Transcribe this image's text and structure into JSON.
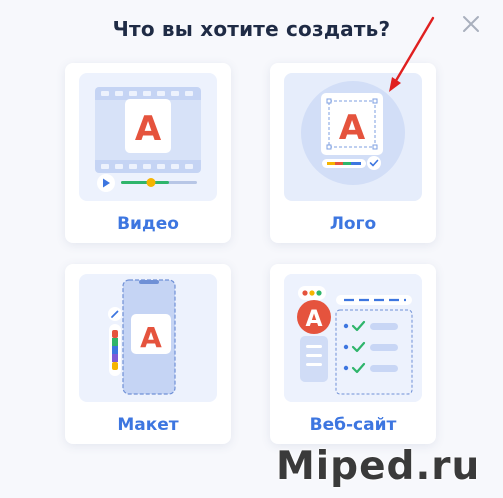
{
  "dialog": {
    "title": "Что вы хотите создать?",
    "close_icon": "close-icon"
  },
  "options": [
    {
      "label": "Видео",
      "icon": "video-template-illustration"
    },
    {
      "label": "Лого",
      "icon": "logo-template-illustration"
    },
    {
      "label": "Макет",
      "icon": "mockup-template-illustration"
    },
    {
      "label": "Веб-сайт",
      "icon": "website-template-illustration"
    }
  ],
  "illustration_letter": "A",
  "annotation": {
    "arrow_color": "#e02020"
  },
  "watermark": "Miped.ru",
  "colors": {
    "accent": "#3d76e0",
    "title": "#1f2b45",
    "brand_red": "#e5533d",
    "check_green": "#2fb56b"
  }
}
